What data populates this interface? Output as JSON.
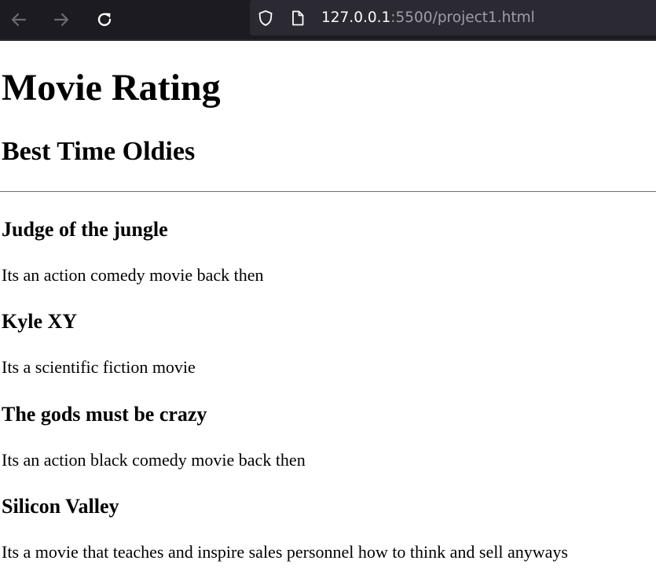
{
  "browser": {
    "url_host": "127.0.0.1",
    "url_rest": ":5500/project1.html",
    "icons": [
      "back-arrow-icon",
      "forward-arrow-icon",
      "reload-icon",
      "shield-icon",
      "page-icon"
    ]
  },
  "page": {
    "title": "Movie Rating",
    "subtitle": "Best Time Oldies",
    "movies": [
      {
        "title": "Judge of the jungle",
        "description": "Its an action comedy movie back then"
      },
      {
        "title": "Kyle XY",
        "description": "Its a scientific fiction movie"
      },
      {
        "title": "The gods must be crazy",
        "description": "Its an action black comedy movie back then"
      },
      {
        "title": "Silicon Valley",
        "description": "Its a movie that teaches and inspire sales personnel how to think and sell anyways"
      }
    ]
  }
}
